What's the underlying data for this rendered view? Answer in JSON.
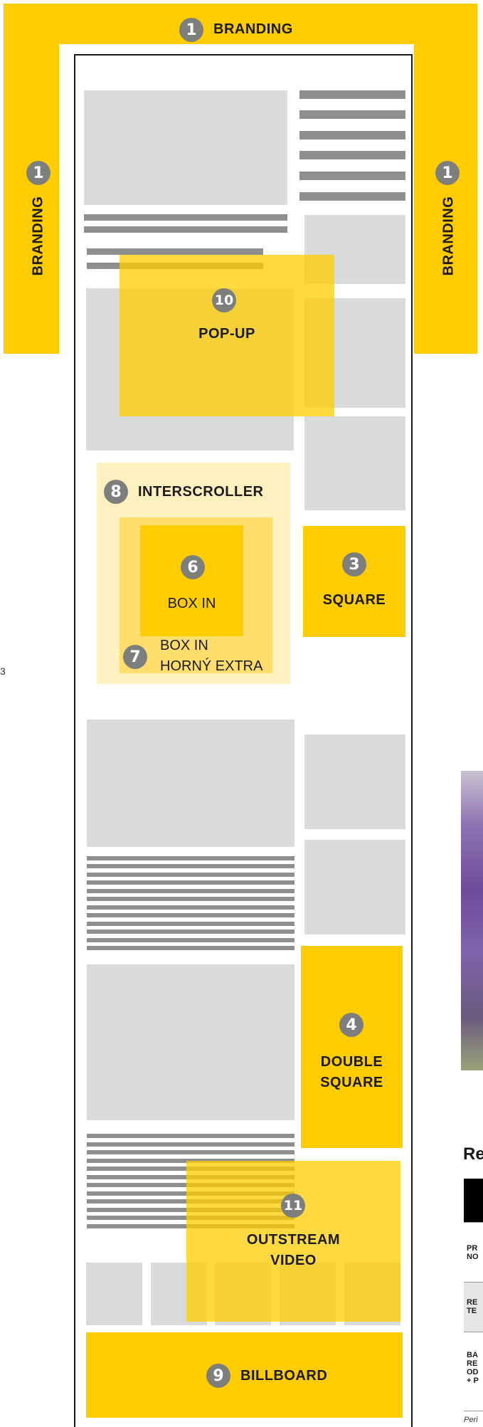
{
  "colors": {
    "accent": "#FFCC00",
    "placeholder": "#d9dadb",
    "text_line": "#8c8e90",
    "badge": "#7d7f7d",
    "frame": "#1a1a1a"
  },
  "diagram": {
    "branding_top": {
      "number": "1",
      "label": "BRANDING"
    },
    "branding_left": {
      "number": "1",
      "label": "BRANDING"
    },
    "branding_right": {
      "number": "1",
      "label": "BRANDING"
    },
    "popup": {
      "number": "10",
      "label": "POP-UP"
    },
    "interscroller": {
      "number": "8",
      "label": "INTERSCROLLER"
    },
    "box_in": {
      "number": "6",
      "label": "BOX IN"
    },
    "box_in_extra": {
      "number": "7",
      "label_line1": "BOX IN",
      "label_line2": "HORNÝ EXTRA"
    },
    "square": {
      "number": "3",
      "label": "SQUARE"
    },
    "double_square": {
      "number": "4",
      "label_line1": "DOUBLE",
      "label_line2": "SQUARE"
    },
    "outstream": {
      "number": "11",
      "label_line1": "OUTSTREAM",
      "label_line2": "VIDEO"
    },
    "billboard": {
      "number": "9",
      "label": "BILLBOARD"
    }
  },
  "sidebar_fragment": {
    "heading": "Re",
    "rows": [
      {
        "line1": "PR",
        "line2": "NO"
      },
      {
        "line1": "RE",
        "line2": "TE"
      },
      {
        "line1": "BA",
        "line2": "RE",
        "line3": "OD",
        "line4": "+ P"
      }
    ],
    "footnote": "Peri"
  },
  "left_edge_char": "3"
}
